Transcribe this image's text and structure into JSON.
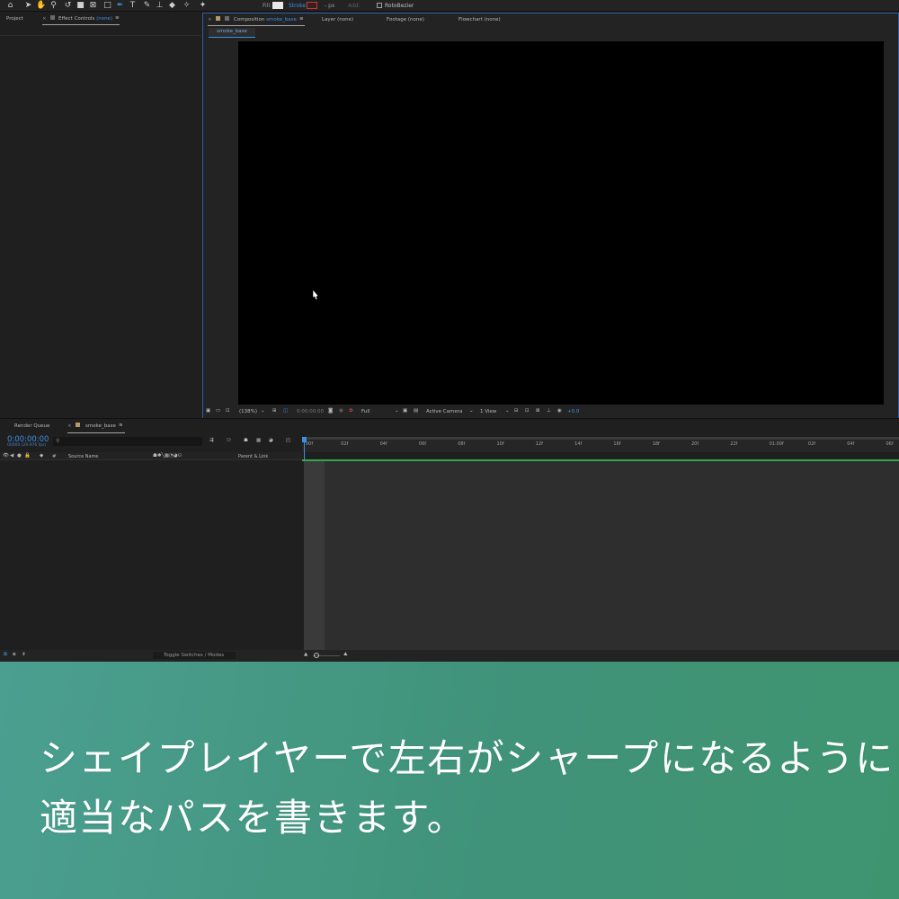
{
  "toolbar": {
    "fill_label": "Fill:",
    "stroke_label": "Stroke:",
    "px_label": "- px",
    "add_label": "Add:",
    "rotobezier_label": "RotoBezier"
  },
  "left_panel": {
    "project_tab": "Project",
    "effect_controls_tab": "Effect Controls",
    "effect_controls_target": "(none)"
  },
  "viewer": {
    "composition_tab": "Composition",
    "composition_name": "smoke_base",
    "layer_tab": "Layer (none)",
    "footage_tab": "Footage (none)",
    "flowchart_tab": "Flowchart (none)",
    "breadcrumb": "smoke_base",
    "zoom": "(138%)",
    "timecode": "0:00:00:00",
    "resolution": "Full",
    "camera": "Active Camera",
    "views": "1 View",
    "exposure": "+0.0"
  },
  "timeline": {
    "render_queue_tab": "Render Queue",
    "comp_tab": "smoke_base",
    "timecode": "0:00:00:00",
    "frame_info": "00000 (29.976 fps)",
    "search_placeholder": "",
    "col_number": "#",
    "col_source_name": "Source Name",
    "col_parent": "Parent & Link",
    "toggle_switches": "Toggle Switches / Modes",
    "ruler_ticks": [
      "00f",
      "02f",
      "04f",
      "06f",
      "08f",
      "10f",
      "12f",
      "14f",
      "16f",
      "18f",
      "20f",
      "22f",
      "01:00f",
      "02f",
      "04f",
      "06f"
    ]
  },
  "caption": {
    "line1": "シェイプレイヤーで左右がシャープになるように",
    "line2": "適当なパスを書きます。"
  },
  "colors": {
    "accent_blue": "#3d8fe3",
    "caption_bg_start": "#4b9f90",
    "caption_bg_end": "#3f9470"
  }
}
